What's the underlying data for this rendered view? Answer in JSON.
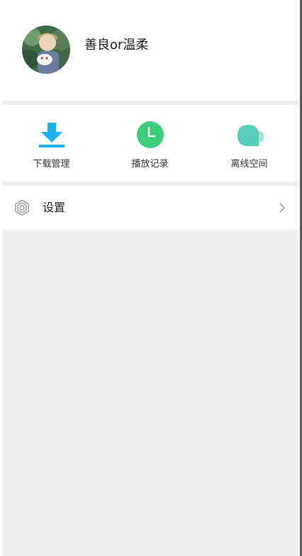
{
  "profile": {
    "username": "善良or温柔"
  },
  "actions": [
    {
      "label": "下载管理",
      "icon": "download-icon",
      "color": "#19b2f1"
    },
    {
      "label": "播放记录",
      "icon": "clock-icon",
      "color": "#3cce7a"
    },
    {
      "label": "离线空间",
      "icon": "cloud-icon",
      "color": "#56cdb8"
    }
  ],
  "settings": {
    "label": "设置"
  },
  "colors": {
    "background_gray": "#eeeff1",
    "download_blue": "#19b2f1",
    "history_green": "#3cce7a",
    "offline_teal": "#56cdb8"
  }
}
